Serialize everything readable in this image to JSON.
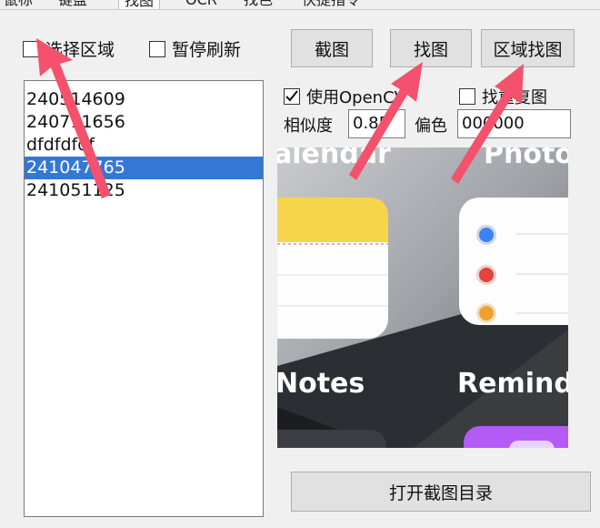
{
  "tabs": [
    "鼠标",
    "键盘",
    "找图",
    "OCR",
    "找色",
    "快捷指令"
  ],
  "checkboxes": {
    "select_region": {
      "label": "选择区域",
      "checked": false
    },
    "pause_refresh": {
      "label": "暂停刷新",
      "checked": false
    },
    "use_opencv": {
      "label": "使用OpenCV",
      "checked": true
    },
    "repeat_image": {
      "label": "找重复图",
      "checked": false
    }
  },
  "buttons": {
    "screenshot": "截图",
    "find_image": "找图",
    "region_find": "区域找图",
    "open_dir": "打开截图目录"
  },
  "image_list": {
    "items": [
      "240514609",
      "240711656",
      "dfdfdfdf",
      "241047765",
      "241051125"
    ],
    "selected_index": 3
  },
  "params": {
    "similarity_label": "相似度",
    "similarity_value": "0.85",
    "offset_label": "偏色",
    "offset_value": "000000"
  },
  "preview": {
    "top_left_text": "alendar",
    "top_right_text": "Photo",
    "bottom_left_text": "Notes",
    "bottom_right_text": "Remind",
    "dot_colors": [
      "#3b82f6",
      "#e0443a",
      "#f0a030"
    ]
  },
  "colors": {
    "selection": "#3478d6",
    "arrow": "#f4516c"
  }
}
